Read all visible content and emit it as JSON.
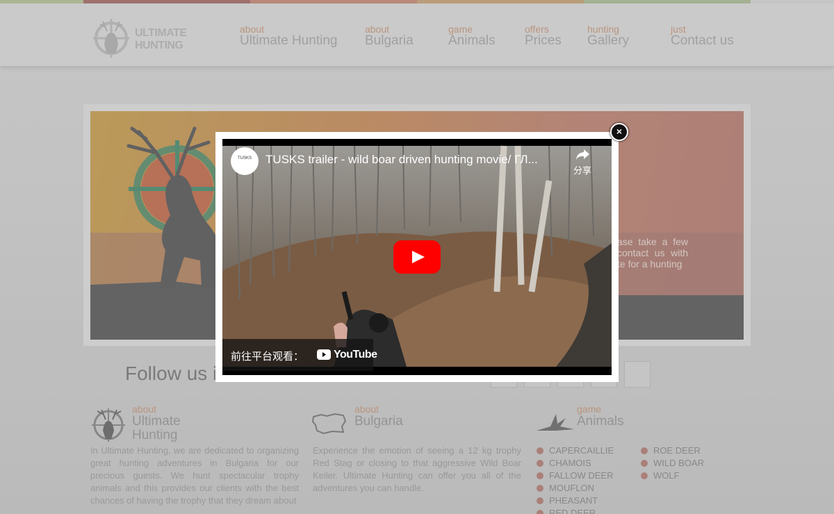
{
  "colors": {
    "stripes": [
      "#b9c49a",
      "#a9706b",
      "#c98c7a",
      "#c9a67c",
      "#aebe98",
      "#d7d7d7"
    ]
  },
  "logo": {
    "line1": "ULTIMATE",
    "line2": "HUNTING"
  },
  "nav": [
    {
      "small": "about",
      "big": "Ultimate Hunting"
    },
    {
      "small": "about",
      "big": "Bulgaria"
    },
    {
      "small": "game",
      "big": "Animals"
    },
    {
      "small": "offers",
      "big": "Prices"
    },
    {
      "small": "hunting",
      "big": "Gallery"
    },
    {
      "small": "just",
      "big": "Contact us"
    }
  ],
  "banner": {
    "text": "ase take a few contact us with te for a hunting"
  },
  "follow": {
    "label": "Follow us i"
  },
  "columns": [
    {
      "small": "about",
      "big1": "Ultimate",
      "big2": "Hunting",
      "text": "In Ultimate Hunting, we are dedicated to organizing great hunting adventures in Bulgaria for our precious guests. We hunt spectacular trophy animals and this provides our clients with the best chances of having the trophy that they dream about"
    },
    {
      "small": "about",
      "big1": "Bulgaria",
      "text": "Experience the emotion of seeing a 12 kg trophy Red Stag or closing to that aggressive Wild Boar Keiler. Ultimate Hunting can offer you all of the adventures you can handle."
    },
    {
      "small": "game",
      "big1": "Animals"
    }
  ],
  "animals_left": [
    "CAPERCAILLIE",
    "CHAMOIS",
    "FALLOW DEER",
    "MOUFLON",
    "PHEASANT",
    "RED DEER"
  ],
  "animals_right": [
    "ROE DEER",
    "WILD BOAR",
    "WOLF"
  ],
  "video": {
    "title": "TUSKS trailer - wild boar driven hunting movie/ ГЛ...",
    "share": "分享",
    "watch_on": "前往平台观看：",
    "youtube": "YouTube",
    "channel_logo": "TUSKS"
  },
  "modal": {
    "close": "×"
  }
}
